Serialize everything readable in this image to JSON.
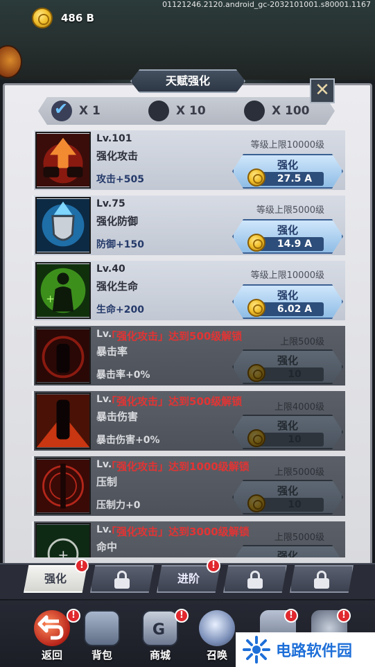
{
  "resource": {
    "amount": "486 B"
  },
  "build_info": "01121246.2120.android_gc-2032101001.s80001.1167",
  "panel": {
    "title": "天赋强化",
    "close_symbol": "✕"
  },
  "multipliers": [
    {
      "label": "X 1",
      "selected": true
    },
    {
      "label": "X 10",
      "selected": false
    },
    {
      "label": "X 100",
      "selected": false
    }
  ],
  "talents": [
    {
      "level": "Lv.101",
      "name": "强化攻击",
      "effect": "攻击+505",
      "cap": "等级上限10000级",
      "button": "强化",
      "price": "27.5 A",
      "locked": false,
      "accent": "#e8542a"
    },
    {
      "level": "Lv.75",
      "name": "强化防御",
      "effect": "防御+150",
      "cap": "等级上限5000级",
      "button": "强化",
      "price": "14.9 A",
      "locked": false,
      "accent": "#2fa7e0"
    },
    {
      "level": "Lv.40",
      "name": "强化生命",
      "effect": "生命+200",
      "cap": "等级上限10000级",
      "button": "强化",
      "price": "6.02 A",
      "locked": false,
      "accent": "#57c22b"
    },
    {
      "level": "Lv.",
      "requirement": "「强化攻击」达到500级解锁",
      "name": "暴击率",
      "effect": "暴击率+0%",
      "cap": "上限500级",
      "button": "强化",
      "price": "10",
      "locked": true,
      "accent": "#a32118"
    },
    {
      "level": "Lv.",
      "requirement": "「强化攻击」达到500级解锁",
      "name": "暴击伤害",
      "effect": "暴击伤害+0%",
      "cap": "上限4000级",
      "button": "强化",
      "price": "10",
      "locked": true,
      "accent": "#c83612"
    },
    {
      "level": "Lv.",
      "requirement": "「强化攻击」达到1000级解锁",
      "name": "压制",
      "effect": "压制力+0",
      "cap": "上限5000级",
      "button": "强化",
      "price": "10",
      "locked": true,
      "accent": "#8b1a12"
    },
    {
      "level": "Lv.",
      "requirement": "「强化攻击」达到3000级解锁",
      "name": "命中",
      "effect": "",
      "cap": "上限5000级",
      "button": "强化",
      "price": "",
      "locked": true,
      "accent": "#2b6a36"
    }
  ],
  "tabs": [
    {
      "label": "强化",
      "active": true,
      "badge": "!"
    },
    {
      "label": "",
      "locked": true
    },
    {
      "label": "进阶",
      "active": false,
      "badge": "!"
    },
    {
      "label": "",
      "locked": true
    },
    {
      "label": "",
      "locked": true
    }
  ],
  "nav": [
    {
      "label": "返回",
      "icon": "back-arrow-icon",
      "badge": "!"
    },
    {
      "label": "背包",
      "icon": "backpack-icon"
    },
    {
      "label": "商城",
      "icon": "shop-icon",
      "badge": "!"
    },
    {
      "label": "召唤",
      "icon": "summon-orb-icon"
    },
    {
      "label": "",
      "icon": "crown-icon",
      "badge": "!"
    },
    {
      "label": "",
      "icon": "more-icon",
      "badge": "!"
    }
  ],
  "watermark": {
    "text": "电路软件园"
  }
}
